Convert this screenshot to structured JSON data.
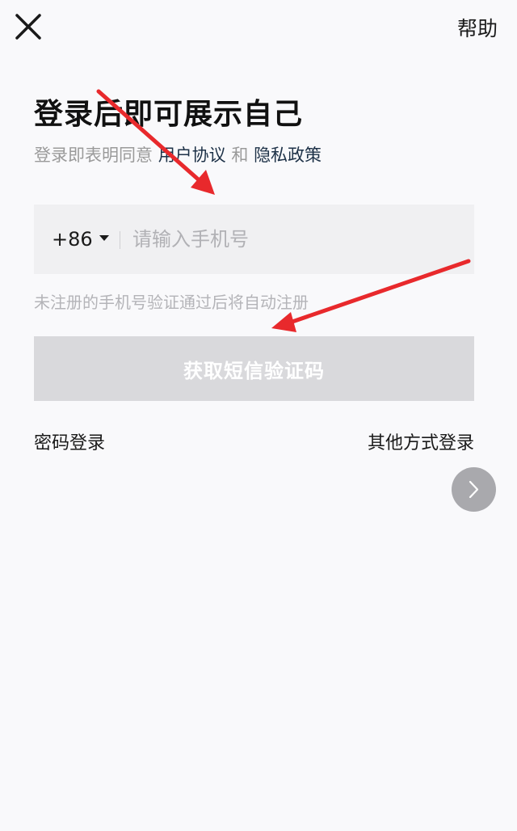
{
  "header": {
    "close_icon": "close-icon",
    "help_label": "帮助"
  },
  "main": {
    "title": "登录后即可展示自己",
    "agreement": {
      "prefix": "登录即表明同意",
      "user_agreement": "用户协议",
      "conjunction": "和",
      "privacy_policy": "隐私政策"
    },
    "phone": {
      "country_code": "+86",
      "value": "",
      "placeholder": "请输入手机号"
    },
    "hint": "未注册的手机号验证通过后将自动注册",
    "sms_button_label": "获取短信验证码",
    "password_login_label": "密码登录",
    "other_login_label": "其他方式登录",
    "next_icon": "chevron-right-icon"
  },
  "colors": {
    "background": "#f9f9fb",
    "link": "#1d3147",
    "disabled_button": "#d9d9dc",
    "annotation_arrow": "#e8292c"
  }
}
